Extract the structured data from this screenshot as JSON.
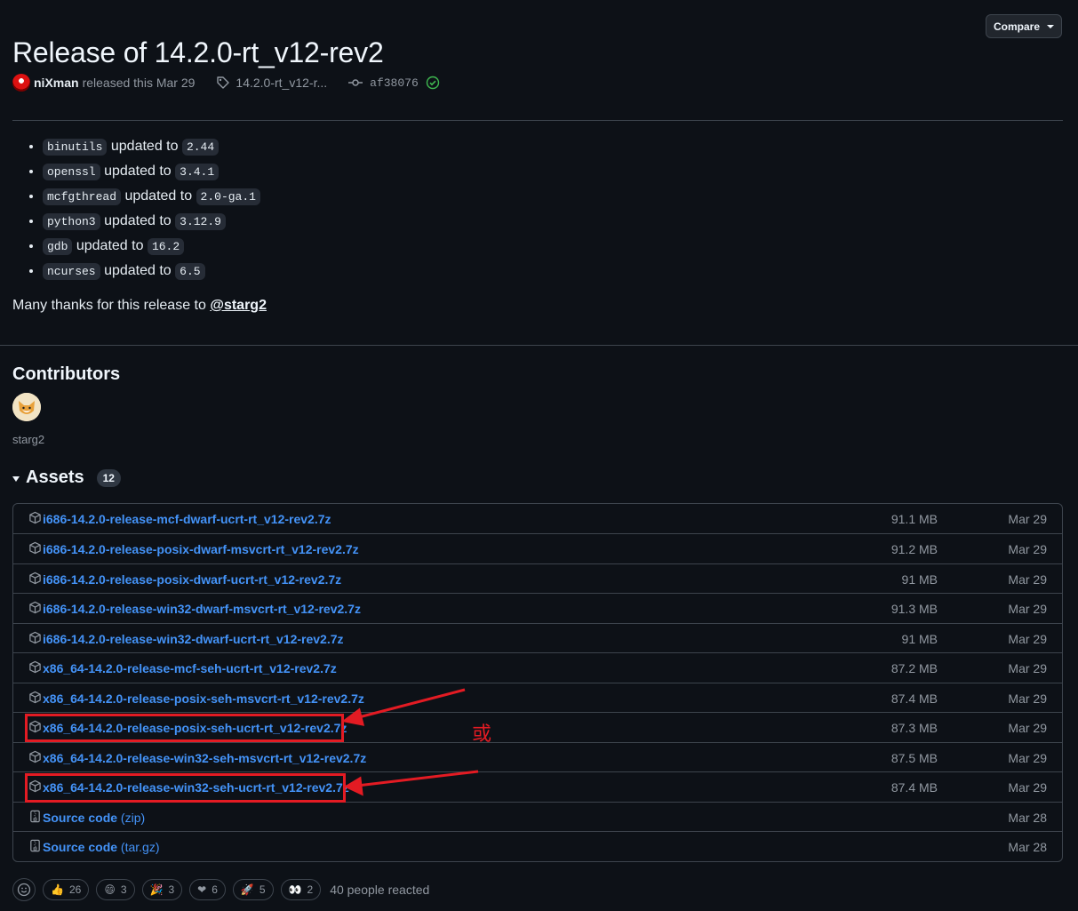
{
  "release": {
    "title": "Release of 14.2.0-rt_v12-rev2",
    "compare_label": "Compare",
    "author": "niXman",
    "released_text": "released this Mar 29",
    "tag": "14.2.0-rt_v12-r...",
    "commit": "af38076"
  },
  "notes": {
    "items": [
      {
        "pkg": "binutils",
        "mid": "updated to",
        "ver": "2.44"
      },
      {
        "pkg": "openssl",
        "mid": "updated to",
        "ver": "3.4.1"
      },
      {
        "pkg": "mcfgthread",
        "mid": "updated to",
        "ver": "2.0-ga.1"
      },
      {
        "pkg": "python3",
        "mid": "updated to",
        "ver": "3.12.9"
      },
      {
        "pkg": "gdb",
        "mid": "updated to",
        "ver": "16.2"
      },
      {
        "pkg": "ncurses",
        "mid": "updated to",
        "ver": "6.5"
      }
    ],
    "thanks_text": "Many thanks for this release to",
    "thanks_user": "@starg2"
  },
  "contributors": {
    "title": "Contributors",
    "names": [
      "starg2"
    ]
  },
  "assets": {
    "title": "Assets",
    "count": "12",
    "rows": [
      {
        "name": "i686-14.2.0-release-mcf-dwarf-ucrt-rt_v12-rev2.7z",
        "size": "91.1 MB",
        "date": "Mar 29"
      },
      {
        "name": "i686-14.2.0-release-posix-dwarf-msvcrt-rt_v12-rev2.7z",
        "size": "91.2 MB",
        "date": "Mar 29"
      },
      {
        "name": "i686-14.2.0-release-posix-dwarf-ucrt-rt_v12-rev2.7z",
        "size": "91 MB",
        "date": "Mar 29"
      },
      {
        "name": "i686-14.2.0-release-win32-dwarf-msvcrt-rt_v12-rev2.7z",
        "size": "91.3 MB",
        "date": "Mar 29"
      },
      {
        "name": "i686-14.2.0-release-win32-dwarf-ucrt-rt_v12-rev2.7z",
        "size": "91 MB",
        "date": "Mar 29"
      },
      {
        "name": "x86_64-14.2.0-release-mcf-seh-ucrt-rt_v12-rev2.7z",
        "size": "87.2 MB",
        "date": "Mar 29"
      },
      {
        "name": "x86_64-14.2.0-release-posix-seh-msvcrt-rt_v12-rev2.7z",
        "size": "87.4 MB",
        "date": "Mar 29"
      },
      {
        "name": "x86_64-14.2.0-release-posix-seh-ucrt-rt_v12-rev2.7z",
        "size": "87.3 MB",
        "date": "Mar 29"
      },
      {
        "name": "x86_64-14.2.0-release-win32-seh-msvcrt-rt_v12-rev2.7z",
        "size": "87.5 MB",
        "date": "Mar 29"
      },
      {
        "name": "x86_64-14.2.0-release-win32-seh-ucrt-rt_v12-rev2.7z",
        "size": "87.4 MB",
        "date": "Mar 29"
      },
      {
        "name": "Source code",
        "suffix": "(zip)",
        "size": "",
        "date": "Mar 28"
      },
      {
        "name": "Source code",
        "suffix": "(tar.gz)",
        "size": "",
        "date": "Mar 28"
      }
    ]
  },
  "annotation": {
    "text": "或",
    "color": "#e31b23"
  },
  "reactions": {
    "items": [
      {
        "icon": "thumbs-up-icon",
        "emoji": "👍",
        "count": "26"
      },
      {
        "icon": "laugh-icon",
        "emoji": "😄",
        "count": "3"
      },
      {
        "icon": "hooray-icon",
        "emoji": "🎉",
        "count": "3"
      },
      {
        "icon": "heart-icon",
        "emoji": "❤",
        "count": "6"
      },
      {
        "icon": "rocket-icon",
        "emoji": "🚀",
        "count": "5"
      },
      {
        "icon": "eyes-icon",
        "emoji": "👀",
        "count": "2"
      }
    ],
    "summary": "40 people reacted"
  },
  "colors": {
    "background": "#0d1117",
    "link": "#4493f8",
    "border": "#3d444d",
    "success": "#3fb950"
  }
}
